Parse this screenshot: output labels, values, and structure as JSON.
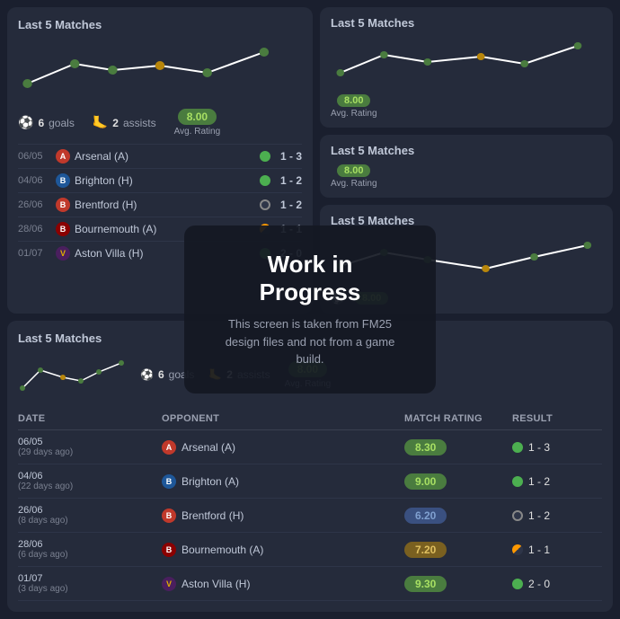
{
  "topLeft": {
    "title": "Last 5 Matches",
    "stats": {
      "goals": 6,
      "assists": 2,
      "avgRating": "8.00",
      "goalsLabel": "goals",
      "assistsLabel": "assists",
      "avgLabel": "Avg. Rating"
    },
    "matches": [
      {
        "date": "06/05",
        "opponent": "Arsenal",
        "venue": "A",
        "badge": "arsenal",
        "dotType": "win",
        "score": "1 - 3"
      },
      {
        "date": "04/06",
        "opponent": "Brighton",
        "venue": "H",
        "badge": "brighton",
        "dotType": "win",
        "score": "1 - 2"
      },
      {
        "date": "26/06",
        "opponent": "Brentford",
        "venue": "H",
        "badge": "brentford",
        "dotType": "loss",
        "score": "1 - 2"
      },
      {
        "date": "28/06",
        "opponent": "Bournemouth",
        "venue": "A",
        "badge": "bournemouth",
        "dotType": "draw",
        "score": "1 - 1"
      },
      {
        "date": "01/07",
        "opponent": "Aston Villa",
        "venue": "H",
        "badge": "villa",
        "dotType": "win",
        "score": "2 - 0"
      }
    ]
  },
  "topRightTop": {
    "title": "Last 5 Matches",
    "avgLabel": "Avg. Rating",
    "avgRating": "8.00"
  },
  "topRightBottom": {
    "title": "Last 5 Matches",
    "avgLabel": "Avg. Rating",
    "avgRating": "8.00"
  },
  "bottomCard": {
    "title": "Last 5 Matches",
    "stats": {
      "goals": 6,
      "assists": 2,
      "avgRating": "8.00",
      "goalsLabel": "goals",
      "assistsLabel": "assists",
      "avgLabel": "Avg. Rating"
    },
    "tableHeaders": [
      "Date",
      "Opponent",
      "Match Rating",
      "Result"
    ],
    "rows": [
      {
        "date": "06/05",
        "ago": "29 days ago",
        "opponent": "Arsenal",
        "venue": "A",
        "badge": "arsenal",
        "rating": "8.30",
        "ratingClass": "rating-high",
        "dotType": "win",
        "score": "1 - 3"
      },
      {
        "date": "04/06",
        "ago": "22 days ago",
        "opponent": "Brighton",
        "venue": "A",
        "badge": "brighton",
        "rating": "9.00",
        "ratingClass": "rating-high",
        "dotType": "win",
        "score": "1 - 2"
      },
      {
        "date": "26/06",
        "ago": "8 days ago",
        "opponent": "Brentford",
        "venue": "H",
        "badge": "brentford",
        "rating": "6.20",
        "ratingClass": "rating-low",
        "dotType": "loss",
        "score": "1 - 2"
      },
      {
        "date": "28/06",
        "ago": "6 days ago",
        "opponent": "Bournemouth",
        "venue": "A",
        "badge": "bournemouth",
        "rating": "7.20",
        "ratingClass": "rating-med",
        "dotType": "draw",
        "score": "1 - 1"
      },
      {
        "date": "01/07",
        "ago": "3 days ago",
        "opponent": "Aston Villa",
        "venue": "H",
        "badge": "villa",
        "rating": "9.30",
        "ratingClass": "rating-high",
        "dotType": "win",
        "score": "2 - 0"
      }
    ]
  },
  "wip": {
    "title": "Work in Progress",
    "description": "This screen is taken from FM25 design files and not from a game build."
  }
}
